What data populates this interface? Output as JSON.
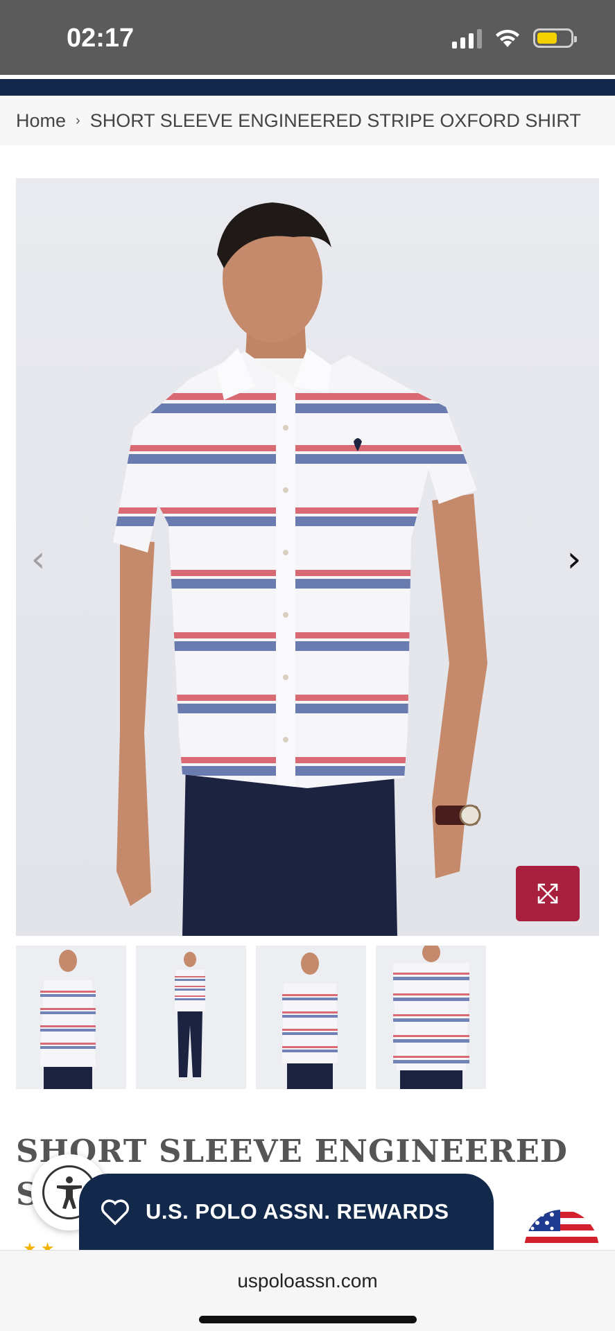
{
  "status_bar": {
    "time": "02:17",
    "battery_color": "#f3d000"
  },
  "breadcrumb": {
    "home": "Home",
    "separator": "›",
    "current": "SHORT SLEEVE ENGINEERED STRIPE OXFORD SHIRT"
  },
  "gallery": {
    "prev_icon": "chevron-left-icon",
    "next_icon": "chevron-right-icon",
    "expand_icon": "expand-icon",
    "thumbnail_count": 4,
    "accent_color": "#a9203e"
  },
  "product": {
    "title": "SHORT SLEEVE ENGINEERED STRIPE OXFORD SHIRT"
  },
  "rewards": {
    "label": "U.S. POLO ASSN. REWARDS",
    "icon": "heart-icon",
    "color": "#13294b"
  },
  "accessibility": {
    "icon": "accessibility-icon"
  },
  "browser": {
    "url": "uspoloassn.com"
  }
}
